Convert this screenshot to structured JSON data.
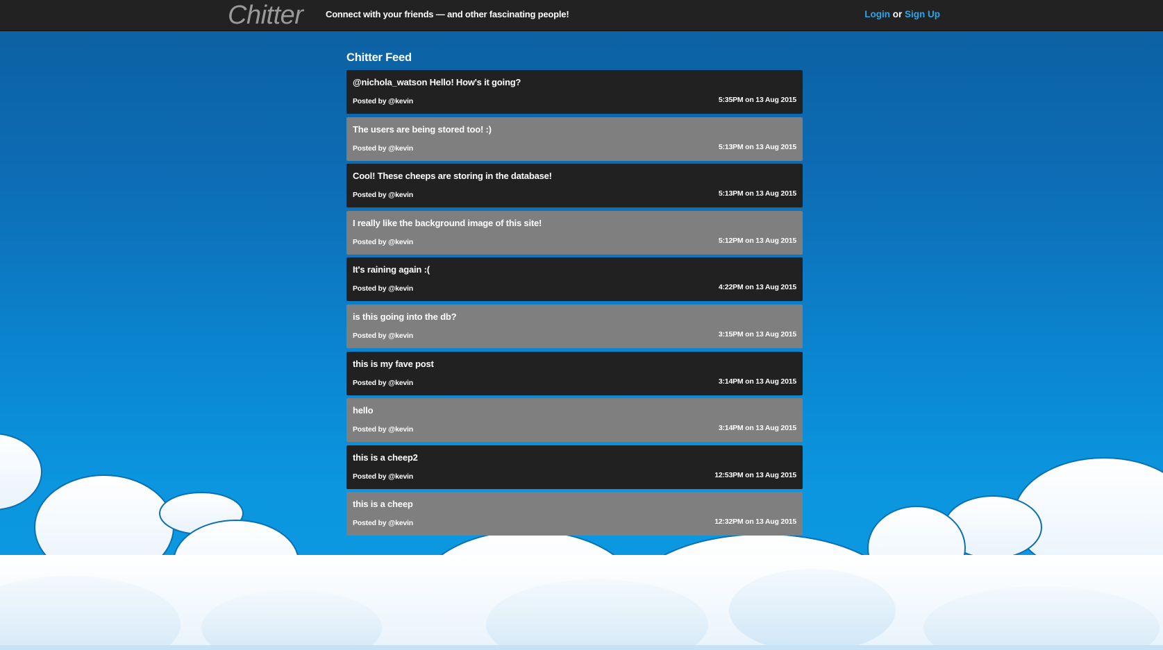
{
  "header": {
    "brand": "Chitter",
    "tagline": "Connect with your friends — and other fascinating people!",
    "login_label": "Login",
    "or_text": "or",
    "signup_label": "Sign Up"
  },
  "feed": {
    "title": "Chitter Feed",
    "peeps": [
      {
        "text": "@nichola_watson Hello! How's it going?",
        "author": "Posted by @kevin",
        "time": "5:35PM on 13 Aug 2015"
      },
      {
        "text": "The users are being stored too! :)",
        "author": "Posted by @kevin",
        "time": "5:13PM on 13 Aug 2015"
      },
      {
        "text": "Cool! These cheeps are storing in the database!",
        "author": "Posted by @kevin",
        "time": "5:13PM on 13 Aug 2015"
      },
      {
        "text": "I really like the background image of this site!",
        "author": "Posted by @kevin",
        "time": "5:12PM on 13 Aug 2015"
      },
      {
        "text": "It's raining again :(",
        "author": "Posted by @kevin",
        "time": "4:22PM on 13 Aug 2015"
      },
      {
        "text": "is this going into the db?",
        "author": "Posted by @kevin",
        "time": "3:15PM on 13 Aug 2015"
      },
      {
        "text": "this is my fave post",
        "author": "Posted by @kevin",
        "time": "3:14PM on 13 Aug 2015"
      },
      {
        "text": "hello",
        "author": "Posted by @kevin",
        "time": "3:14PM on 13 Aug 2015"
      },
      {
        "text": "this is a cheep2",
        "author": "Posted by @kevin",
        "time": "12:53PM on 13 Aug 2015"
      },
      {
        "text": "this is a cheep",
        "author": "Posted by @kevin",
        "time": "12:32PM on 13 Aug 2015"
      }
    ]
  },
  "colors": {
    "navbar": "#222222",
    "link": "#2aa6e8",
    "peep_dark": "#212121",
    "peep_light": "#7f7f7f",
    "sky": "#0b84cf"
  }
}
